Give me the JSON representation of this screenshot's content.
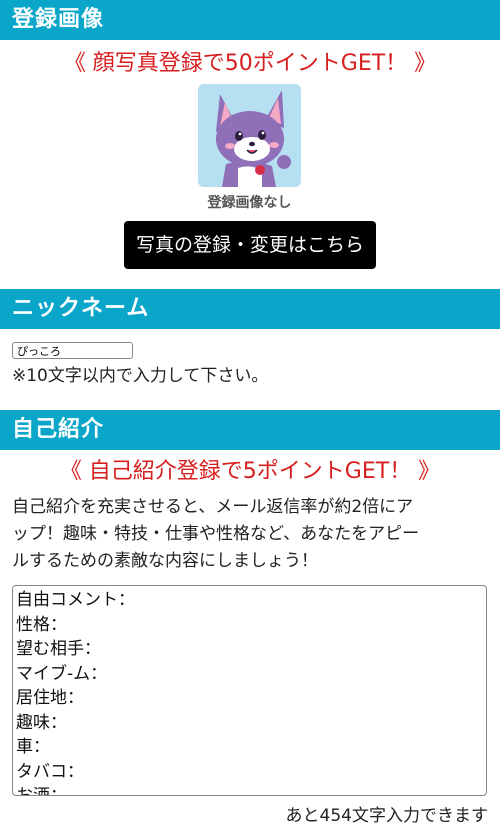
{
  "sections": {
    "photo": {
      "title": "登録画像"
    },
    "nickname": {
      "title": "ニックネーム"
    },
    "intro": {
      "title": "自己紹介"
    }
  },
  "photo": {
    "promo": "《 顔写真登録で50ポイントGET！ 》",
    "avatar_caption": "登録画像なし",
    "button_label": "写真の登録・変更はこちら"
  },
  "nickname": {
    "value": "ぴっころ",
    "note": "※10文字以内で入力して下さい。"
  },
  "intro": {
    "promo": "《 自己紹介登録で5ポイントGET！ 》",
    "description_lines": [
      "自己紹介を充実させると、メール返信率が約2倍にア",
      "ップ！趣味・特技・仕事や性格など、あなたをアピー",
      "ルするための素敵な内容にしましょう！"
    ],
    "textarea_lines": [
      "自由コメント：",
      "性格：",
      "望む相手：",
      "マイブ-ム：",
      "居住地：",
      "趣味：",
      "車：",
      "タバコ：",
      "お酒："
    ],
    "counter": "あと454文字入力できます"
  },
  "colors": {
    "header_bg": "#0aa6c9",
    "promo_text": "#d81f1f",
    "button_bg": "#000000",
    "avatar_bg": "#b7dff2",
    "cat_purple": "#8e6fb8"
  },
  "icons": {
    "avatar": "purple-cat-mascot-icon"
  }
}
